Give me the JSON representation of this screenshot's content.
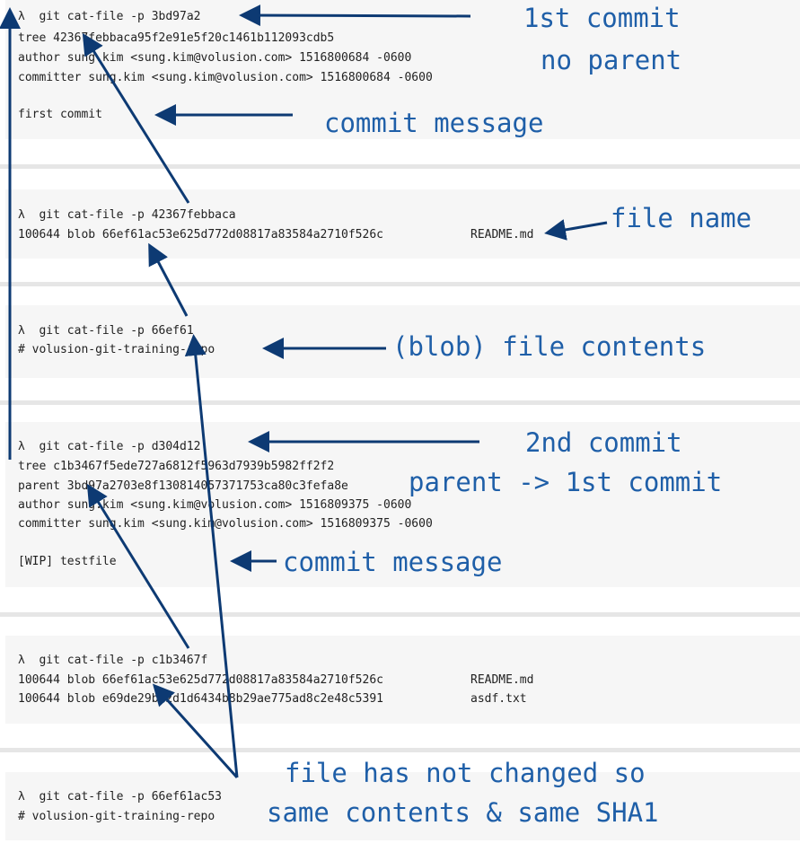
{
  "blocks": {
    "b1": {
      "lines": [
        "λ  git cat-file -p 3bd97a2",
        "tree 42367febbaca95f2e91e5f20c1461b112093cdb5",
        "author sung.kim <sung.kim@volusion.com> 1516800684 -0600",
        "committer sung.kim <sung.kim@volusion.com> 1516800684 -0600",
        "first commit"
      ]
    },
    "b2": {
      "lines": [
        "λ  git cat-file -p 42367febbaca",
        "100644 blob 66ef61ac53e625d772d08817a83584a2710f526c",
        "README.md"
      ]
    },
    "b3": {
      "lines": [
        "λ  git cat-file -p 66ef61",
        "# volusion-git-training-repo"
      ]
    },
    "b4": {
      "lines": [
        "λ  git cat-file -p d304d12",
        "tree c1b3467f5ede727a6812f5963d7939b5982ff2f2",
        "parent 3bd97a2703e8f130814057371753ca80c3fefa8e",
        "author sung.kim <sung.kim@volusion.com> 1516809375 -0600",
        "committer sung.kim <sung.kim@volusion.com> 1516809375 -0600",
        "[WIP] testfile"
      ]
    },
    "b5": {
      "lines": [
        "λ  git cat-file -p c1b3467f",
        "100644 blob 66ef61ac53e625d772d08817a83584a2710f526c",
        "README.md",
        "100644 blob e69de29bb2d1d6434b8b29ae775ad8c2e48c5391",
        "asdf.txt"
      ]
    },
    "b6": {
      "lines": [
        "λ  git cat-file -p 66ef61ac53",
        "# volusion-git-training-repo"
      ]
    }
  },
  "annotations": {
    "first_commit": "1st commit",
    "no_parent": "no parent",
    "commit_message_1": "commit message",
    "file_name": "file name",
    "blob_contents": "(blob) file contents",
    "second_commit": "2nd commit",
    "parent_first": "parent -> 1st commit",
    "commit_message_2": "commit message",
    "unchanged_1": "file has not changed so",
    "unchanged_2": "same contents & same SHA1"
  },
  "colors": {
    "arrow": "#0d3a73",
    "annotation": "#1f5fa8",
    "panel": "#f6f6f6",
    "separator": "#e6e6e6",
    "terminal_text": "#222222"
  }
}
